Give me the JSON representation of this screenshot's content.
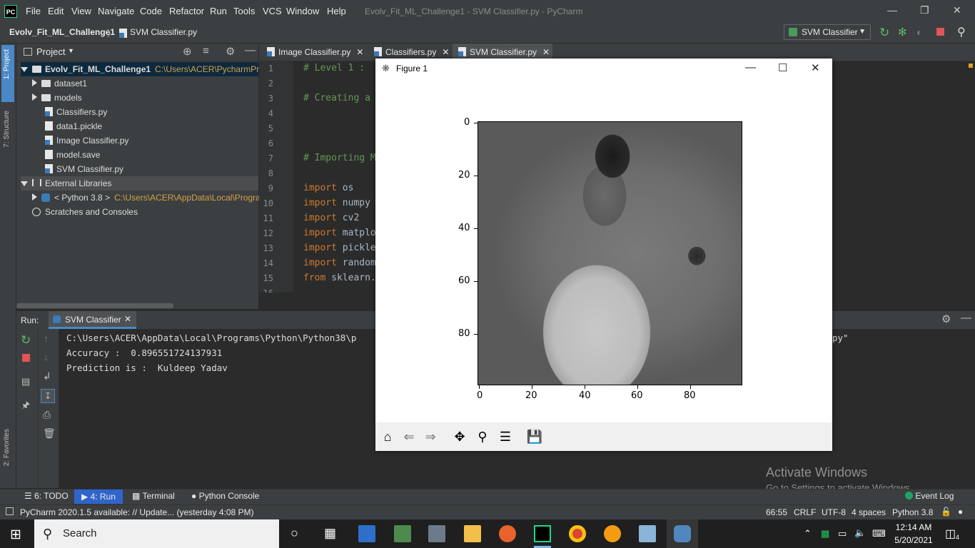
{
  "titlebar": {
    "logo": "PC",
    "menus": [
      "File",
      "Edit",
      "View",
      "Navigate",
      "Code",
      "Refactor",
      "Run",
      "Tools",
      "VCS",
      "Window",
      "Help"
    ],
    "title": "Evolv_Fit_ML_Challenge1 - SVM Classifier.py - PyCharm"
  },
  "navbar": {
    "project": "Evolv_Fit_ML_Challenge1",
    "separator": "〉",
    "file": "SVM Classifier.py",
    "run_config": "SVM Classifier"
  },
  "left_stripe": {
    "project": "1: Project",
    "structure": "7: Structure",
    "favorites": "2: Favorites"
  },
  "project_panel": {
    "title": "Project",
    "root": {
      "label": "Evolv_Fit_ML_Challenge1",
      "path": "C:\\Users\\ACER\\PycharmProje"
    },
    "items": [
      {
        "label": "dataset1",
        "kind": "folder"
      },
      {
        "label": "models",
        "kind": "folder"
      },
      {
        "label": "Classifiers.py",
        "kind": "py"
      },
      {
        "label": "data1.pickle",
        "kind": "file"
      },
      {
        "label": "Image Classifier.py",
        "kind": "py"
      },
      {
        "label": "model.save",
        "kind": "file"
      },
      {
        "label": "SVM Classifier.py",
        "kind": "py"
      }
    ],
    "external": "External Libraries",
    "python": {
      "label": "< Python 3.8 >",
      "path": "C:\\Users\\ACER\\AppData\\Local\\Progra"
    },
    "scratches": "Scratches and Consoles"
  },
  "editor": {
    "tabs": [
      "Image Classifier.py",
      "Classifiers.py",
      "SVM Classifier.py"
    ],
    "lines": [
      {
        "n": "1",
        "text": "# Level 1 :"
      },
      {
        "n": "2",
        "text": ""
      },
      {
        "n": "3",
        "text": "# Creating a"
      },
      {
        "n": "4",
        "text": ""
      },
      {
        "n": "5",
        "text": ""
      },
      {
        "n": "6",
        "text": ""
      },
      {
        "n": "7",
        "text": "# Importing M"
      },
      {
        "n": "8",
        "text": ""
      },
      {
        "n": "9",
        "kw": "import",
        "text": " os"
      },
      {
        "n": "10",
        "kw": "import",
        "text": " numpy"
      },
      {
        "n": "11",
        "kw": "import",
        "text": " cv2"
      },
      {
        "n": "12",
        "kw": "import",
        "text": " matplo"
      },
      {
        "n": "13",
        "kw": "import",
        "text": " pickle"
      },
      {
        "n": "14",
        "kw": "import",
        "text": " random"
      },
      {
        "n": "15",
        "kw": "from",
        "text": " sklearn."
      },
      {
        "n": "16",
        "text": ""
      }
    ]
  },
  "run_panel": {
    "label": "Run:",
    "tab": "SVM Classifier",
    "output": [
      "C:\\Users\\ACER\\AppData\\Local\\Programs\\Python\\Python38\\p",
      "Accuracy :  0.896551724137931",
      "Prediction is :  Kuldeep Yadav"
    ],
    "output_tail": "py\""
  },
  "figure": {
    "title": "Figure 1",
    "y_ticks": [
      "0",
      "20",
      "40",
      "60",
      "80"
    ],
    "x_ticks": [
      "0",
      "20",
      "40",
      "60",
      "80"
    ]
  },
  "bottom_tabs": [
    "6: TODO",
    "4: Run",
    "Terminal",
    "Python Console"
  ],
  "event_log": "Event Log",
  "status": {
    "message": "PyCharm 2020.1.5 available: // Update... (yesterday 4:08 PM)",
    "position": "66:55",
    "line_sep": "CRLF",
    "encoding": "UTF-8",
    "indent": "4 spaces",
    "interpreter": "Python 3.8"
  },
  "activate": {
    "title": "Activate Windows",
    "sub": "Go to Settings to activate Windows."
  },
  "taskbar": {
    "search": "Search",
    "time": "12:14 AM",
    "date": "5/20/2021",
    "notifications": "4"
  }
}
